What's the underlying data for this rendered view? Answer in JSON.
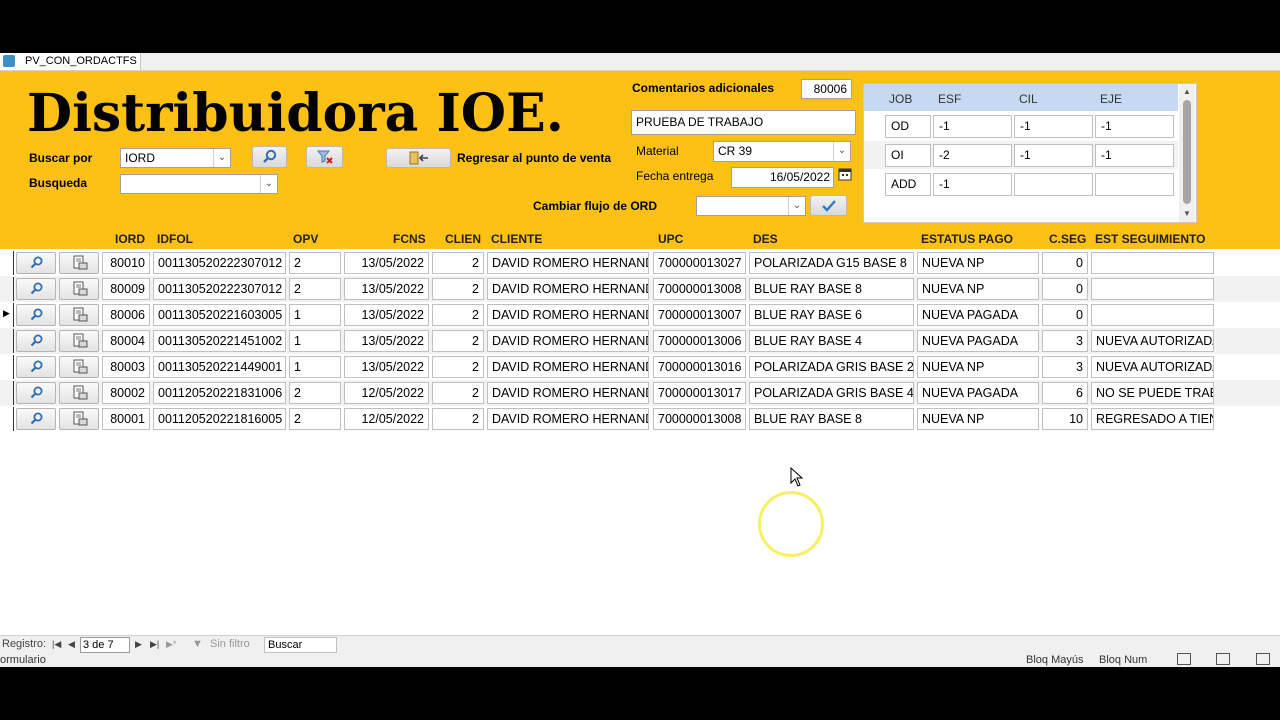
{
  "window": {
    "tab_title": "PV_CON_ORDACTFS"
  },
  "header": {
    "title": "Distribuidora IOE.",
    "buscar_por_label": "Buscar por",
    "buscar_por_value": "IORD",
    "busqueda_label": "Busqueda",
    "busqueda_value": "",
    "regresar_label": "Regresar al punto de venta",
    "comentarios_label": "Comentarios adicionales",
    "order_number": "80006",
    "comentarios_value": "PRUEBA DE TRABAJO",
    "material_label": "Material",
    "material_value": "CR 39",
    "fecha_label": "Fecha entrega",
    "fecha_value": "16/05/2022",
    "cambiar_flujo_label": "Cambiar flujo de ORD",
    "cambiar_flujo_value": ""
  },
  "job": {
    "headers": [
      "JOB",
      "ESF",
      "CIL",
      "EJE"
    ],
    "rows": [
      {
        "label": "OD",
        "esf": "-1",
        "cil": "-1",
        "eje": "-1"
      },
      {
        "label": "OI",
        "esf": "-2",
        "cil": "-1",
        "eje": "-1"
      },
      {
        "label": "ADD",
        "esf": "-1",
        "cil": "",
        "eje": ""
      }
    ]
  },
  "columns": {
    "iord": "IORD",
    "idfol": "IDFOL",
    "opv": "OPV",
    "fcns": "FCNS",
    "clien": "CLIEN",
    "cliente": "CLIENTE",
    "upc": "UPC",
    "des": "DES",
    "estatus": "ESTATUS PAGO",
    "cseg": "C.SEG",
    "est_seg": "EST SEGUIMIENTO"
  },
  "rows": [
    {
      "iord": "80010",
      "idfol": "001130520222307012",
      "opv": "2",
      "fcns": "13/05/2022",
      "clien": "2",
      "cliente": "DAVID ROMERO HERNANDEZ",
      "upc": "700000013027",
      "des": "POLARIZADA G15 BASE 8",
      "estatus": "NUEVA NP",
      "cseg": "0",
      "est_seg": ""
    },
    {
      "iord": "80009",
      "idfol": "001130520222307012",
      "opv": "2",
      "fcns": "13/05/2022",
      "clien": "2",
      "cliente": "DAVID ROMERO HERNANDEZ",
      "upc": "700000013008",
      "des": "BLUE RAY BASE 8",
      "estatus": "NUEVA NP",
      "cseg": "0",
      "est_seg": ""
    },
    {
      "iord": "80006",
      "idfol": "001130520221603005",
      "opv": "1",
      "fcns": "13/05/2022",
      "clien": "2",
      "cliente": "DAVID ROMERO HERNANDEZ",
      "upc": "700000013007",
      "des": "BLUE RAY BASE 6",
      "estatus": "NUEVA PAGADA",
      "cseg": "0",
      "est_seg": ""
    },
    {
      "iord": "80004",
      "idfol": "001130520221451002",
      "opv": "1",
      "fcns": "13/05/2022",
      "clien": "2",
      "cliente": "DAVID ROMERO HERNANDEZ",
      "upc": "700000013006",
      "des": "BLUE RAY BASE 4",
      "estatus": "NUEVA PAGADA",
      "cseg": "3",
      "est_seg": "NUEVA AUTORIZADA"
    },
    {
      "iord": "80003",
      "idfol": "001130520221449001",
      "opv": "1",
      "fcns": "13/05/2022",
      "clien": "2",
      "cliente": "DAVID ROMERO HERNANDEZ",
      "upc": "700000013016",
      "des": "POLARIZADA GRIS BASE 2",
      "estatus": "NUEVA NP",
      "cseg": "3",
      "est_seg": "NUEVA AUTORIZADA"
    },
    {
      "iord": "80002",
      "idfol": "001120520221831006",
      "opv": "2",
      "fcns": "12/05/2022",
      "clien": "2",
      "cliente": "DAVID ROMERO HERNANDEZ",
      "upc": "700000013017",
      "des": "POLARIZADA GRIS BASE 4",
      "estatus": "NUEVA PAGADA",
      "cseg": "6",
      "est_seg": "NO SE PUEDE TRABAJAR"
    },
    {
      "iord": "80001",
      "idfol": "001120520221816005",
      "opv": "2",
      "fcns": "12/05/2022",
      "clien": "2",
      "cliente": "DAVID ROMERO HERNANDEZ",
      "upc": "700000013008",
      "des": "BLUE RAY BASE 8",
      "estatus": "NUEVA NP",
      "cseg": "10",
      "est_seg": "REGRESADO A TIENDA"
    }
  ],
  "navigation": {
    "registro_label": "Registro:",
    "record_position": "3 de 7",
    "filter_label": "Sin filtro",
    "search_label": "Buscar"
  },
  "status": {
    "left": "ormulario",
    "caps": "Bloq Mayús",
    "num": "Bloq Num"
  },
  "colors": {
    "header_bg": "#fcc114",
    "job_header_bg": "#c6d9f1"
  }
}
